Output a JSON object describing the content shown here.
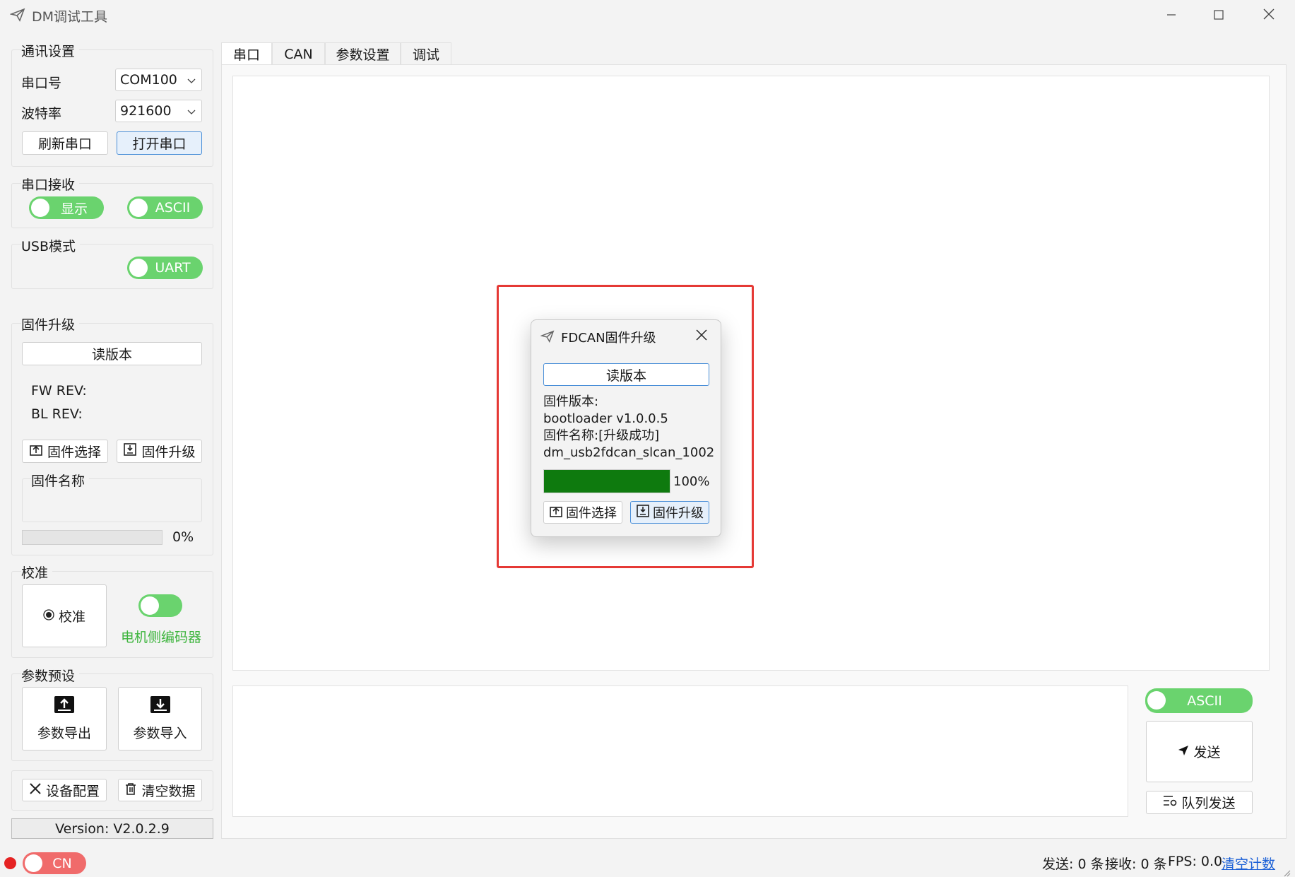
{
  "window": {
    "title": "DM调试工具"
  },
  "comm": {
    "title": "通讯设置",
    "port_label": "串口号",
    "port_value": "COM100",
    "baud_label": "波特率",
    "baud_value": "921600",
    "refresh_label": "刷新串口",
    "open_label": "打开串口"
  },
  "recv": {
    "title": "串口接收",
    "display_toggle": "显示",
    "ascii_toggle": "ASCII"
  },
  "usb": {
    "title": "USB模式",
    "uart_toggle": "UART"
  },
  "firmware": {
    "title": "固件升级",
    "read_version": "读版本",
    "fw_rev": "FW REV:",
    "bl_rev": "BL REV:",
    "select_label": "固件选择",
    "upgrade_label": "固件升级",
    "name_title": "固件名称",
    "progress_text": "0%",
    "progress_fraction": 0
  },
  "calib": {
    "title": "校准",
    "radio_label": "校准",
    "encoder_label": "电机侧编码器"
  },
  "preset": {
    "title": "参数预设",
    "export_label": "参数导出",
    "import_label": "参数导入"
  },
  "actions": {
    "device_config": "设备配置",
    "clear_data": "清空数据"
  },
  "version": "Version: V2.0.2.9",
  "tabs": [
    {
      "label": "串口"
    },
    {
      "label": "CAN"
    },
    {
      "label": "参数设置"
    },
    {
      "label": "调试"
    }
  ],
  "send": {
    "ascii_toggle": "ASCII",
    "send_label": "发送",
    "queue_label": "队列发送"
  },
  "status": {
    "lang": "CN",
    "sent": "发送: 0 条",
    "received": "接收: 0 条",
    "fps": "FPS: 0.0",
    "clear_count": "清空计数"
  },
  "dialog": {
    "title": "FDCAN固件升级",
    "read_version": "读版本",
    "lines": [
      "固件版本:",
      "bootloader v1.0.0.5",
      "固件名称:[升级成功]",
      "dm_usb2fdcan_slcan_1002"
    ],
    "progress_text": "100%",
    "progress_fraction": 1.0,
    "select_label": "固件选择",
    "upgrade_label": "固件升级"
  },
  "colors": {
    "toggle_green": "#6ad36e",
    "progress_green": "#0e7a0e",
    "highlight_red": "#e53935",
    "link_blue": "#1a5fd6",
    "status_dot": "#e52222"
  }
}
